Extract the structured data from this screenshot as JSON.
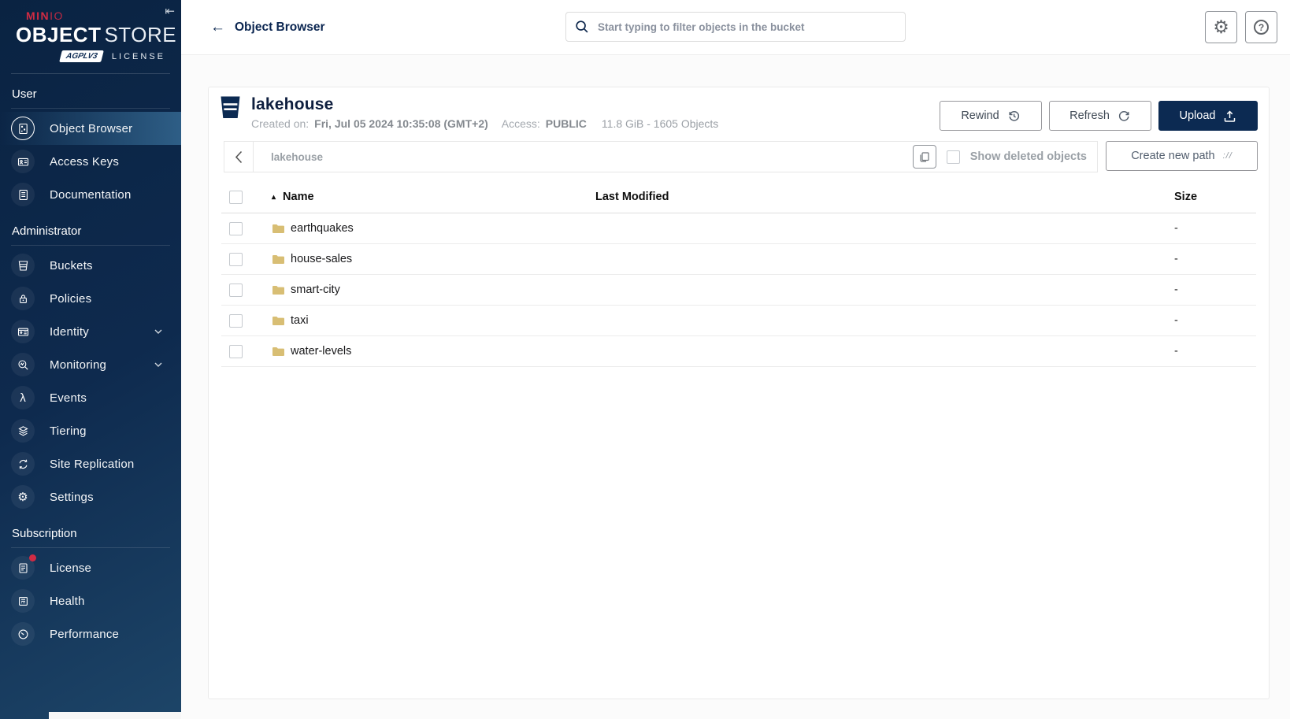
{
  "brand": {
    "name_bold": "MIN",
    "name_light": "IO",
    "product_bold": "OBJECT",
    "product_light": "STORE",
    "badge": "AGPLV3",
    "license_label": "LICENSE"
  },
  "icons": {
    "collapse_glyph": "⇤",
    "back_glyph": "←",
    "settings_glyph": "⚙",
    "help_glyph": "?",
    "events_glyph": "λ",
    "sort_caret": "▴",
    "create_path_glyph": "://"
  },
  "sidebar": {
    "sections": [
      {
        "label": "User",
        "items": [
          {
            "label": "Object Browser",
            "icon": "object-browser-icon",
            "selected": true
          },
          {
            "label": "Access Keys",
            "icon": "access-keys-icon",
            "selected": false
          },
          {
            "label": "Documentation",
            "icon": "documentation-icon",
            "selected": false
          }
        ]
      },
      {
        "label": "Administrator",
        "items": [
          {
            "label": "Buckets",
            "icon": "buckets-icon"
          },
          {
            "label": "Policies",
            "icon": "policies-icon"
          },
          {
            "label": "Identity",
            "icon": "identity-icon",
            "expandable": true
          },
          {
            "label": "Monitoring",
            "icon": "monitoring-icon",
            "expandable": true
          },
          {
            "label": "Events",
            "icon": "events-icon"
          },
          {
            "label": "Tiering",
            "icon": "tiering-icon"
          },
          {
            "label": "Site Replication",
            "icon": "site-replication-icon"
          },
          {
            "label": "Settings",
            "icon": "settings-icon"
          }
        ]
      },
      {
        "label": "Subscription",
        "items": [
          {
            "label": "License",
            "icon": "license-icon",
            "notification": true
          },
          {
            "label": "Health",
            "icon": "health-icon"
          },
          {
            "label": "Performance",
            "icon": "performance-icon"
          }
        ]
      }
    ]
  },
  "header": {
    "title": "Object Browser",
    "search_placeholder": "Start typing to filter objects in the bucket"
  },
  "bucket": {
    "name": "lakehouse",
    "created_label": "Created on:",
    "created_value": "Fri, Jul 05 2024 10:35:08 (GMT+2)",
    "access_label": "Access:",
    "access_value": "PUBLIC",
    "stats": "11.8 GiB - 1605 Objects"
  },
  "actions": {
    "rewind": "Rewind",
    "refresh": "Refresh",
    "upload": "Upload",
    "show_deleted": "Show deleted objects",
    "create_new_path": "Create new path"
  },
  "pathbar": {
    "current_path": "lakehouse"
  },
  "table": {
    "headers": {
      "name": "Name",
      "last_modified": "Last Modified",
      "size": "Size"
    },
    "rows": [
      {
        "name": "earthquakes",
        "size": "-"
      },
      {
        "name": "house-sales",
        "size": "-"
      },
      {
        "name": "smart-city",
        "size": "-"
      },
      {
        "name": "taxi",
        "size": "-"
      },
      {
        "name": "water-levels",
        "size": "-"
      }
    ]
  },
  "colors": {
    "brand_red": "#cf2b43",
    "navy": "#0c2a52",
    "sidebar_highlight": "#2e5e86",
    "folder": "#d8be74"
  }
}
